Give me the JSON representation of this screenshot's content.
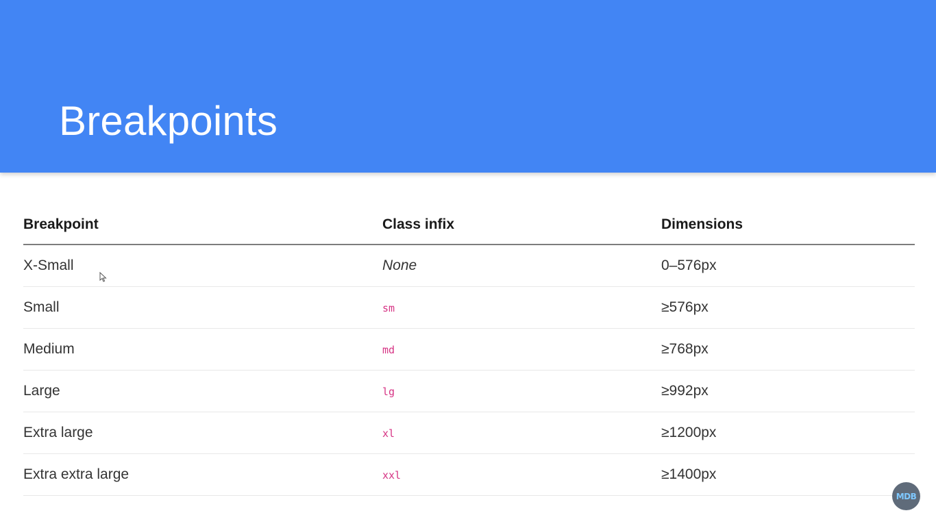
{
  "header": {
    "title": "Breakpoints",
    "background": "#4285f4"
  },
  "table": {
    "columns": [
      "Breakpoint",
      "Class infix",
      "Dimensions"
    ],
    "rows": [
      {
        "breakpoint": "X-Small",
        "infix": "None",
        "dimensions": "0–576px"
      },
      {
        "breakpoint": "Small",
        "infix": "sm",
        "dimensions": "≥576px"
      },
      {
        "breakpoint": "Medium",
        "infix": "md",
        "dimensions": "≥768px"
      },
      {
        "breakpoint": "Large",
        "infix": "lg",
        "dimensions": "≥992px"
      },
      {
        "breakpoint": "Extra large",
        "infix": "xl",
        "dimensions": "≥1200px"
      },
      {
        "breakpoint": "Extra extra large",
        "infix": "xxl",
        "dimensions": "≥1400px"
      }
    ],
    "code_color": "#d63384"
  },
  "badge": {
    "label": "MDB"
  },
  "icons": {
    "cursor": "mouse-cursor-icon"
  }
}
